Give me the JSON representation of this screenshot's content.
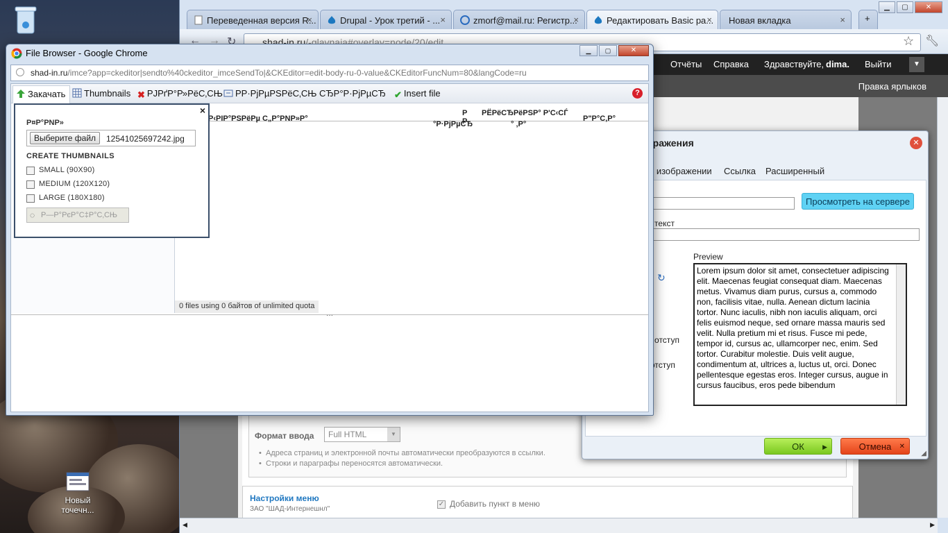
{
  "desktop": {
    "recycle_bin_icon": "trash-icon",
    "shortcut_label_line1": "Новый",
    "shortcut_label_line2": "точечн..."
  },
  "browser_back": {
    "tabs": [
      {
        "label": "Переведенная версия R...",
        "active": false
      },
      {
        "label": "Drupal - Урок третий - ...",
        "active": false
      },
      {
        "label": "zmorf@mail.ru: Регистр...",
        "active": false
      },
      {
        "label": "Редактировать Basic pa...",
        "active": true
      },
      {
        "label": "Новая вкладка",
        "active": false
      }
    ],
    "address_host": "shad-in.ru",
    "address_path": "/-glavnaja#overlay=node/20/edit",
    "admin_menu": {
      "reports": "Отчёты",
      "help": "Справка",
      "greeting": "Здравствуйте,",
      "username": "dima.",
      "logout": "Выйти"
    },
    "shortcut_link": "Правка ярлыков",
    "form": {
      "format_label": "Формат ввода",
      "format_value": "Full HTML",
      "hint1": "Адреса страниц и электронной почты автоматически преобразуются в ссылки.",
      "hint2": "Строки и параграфы переносятся автоматически.",
      "menu_settings": "Настройки меню",
      "menu_sub": "ЗАО \"ШАД-Интернешнл\"",
      "add_menu_item": "Добавить пункт в меню"
    }
  },
  "ck_dialog": {
    "title_fragment": "бражения",
    "tabs": [
      "о изображении",
      "Ссылка",
      "Расширенный"
    ],
    "browse_server": "Просмотреть на сервере",
    "alt_text_fragment": "й текст",
    "preview_label": "Preview",
    "preview_text": "Lorem ipsum dolor sit amet, consectetuer adipiscing elit. Maecenas feugiat consequat diam. Maecenas metus. Vivamus diam purus, cursus a, commodo non, facilisis vitae, nulla. Aenean dictum lacinia tortor. Nunc iaculis, nibh non iaculis aliquam, orci felis euismod neque, sed ornare massa mauris sed velit. Nulla pretium mi et risus. Fusce mi pede, tempor id, cursus ac, ullamcorper nec, enim. Sed tortor. Curabitur molestie. Duis velit augue, condimentum at, ultrices a, luctus ut, orci. Donec pellentesque egestas eros. Integer cursus, augue in cursus faucibus, eros pede bibendum",
    "hspace_fragment": "й отступ",
    "vspace_fragment": "отступ",
    "ok": "ОК",
    "cancel": "Отмена"
  },
  "file_browser": {
    "window_title": "File Browser - Google Chrome",
    "url_host": "shad-in.ru",
    "url_rest": "/imce?app=ckeditor|sendto%40ckeditor_imceSendTo|&CKEditor=edit-body-ru-0-value&CKEditorFuncNum=80&langCode=ru",
    "toolbar": {
      "upload": "Закачать",
      "thumbnails": "Thumbnails",
      "delete": "PJРґР°Р»РёС‚СЊ",
      "resize": "РР·РјРµРЅРёС‚СЊ СЂР°Р·РјРµСЂ",
      "insert": "Insert file",
      "help_icon": "help-icon"
    },
    "columns": {
      "name": "P‹PIP°PSPёPµ С„P°PNP»P°",
      "size_top": "Р Р",
      "size_bottom": "°Р·РјРµСЂ",
      "dims_top": "РЁРёСЂРёРЅР° Р'С‹СЃ",
      "dims_bottom": "° ‚Р°",
      "date": "Р\"P°С‚P°"
    },
    "status": "0 files using 0 байтов of unlimited quota",
    "upload_form": {
      "file_label": "Р¤Р°РNР»",
      "choose_button": "Выберите файл",
      "chosen_file": "12541025697242.jpg",
      "thumbs_heading": "CREATE THUMBNAILS",
      "options": [
        {
          "label": "SMALL (90X90)",
          "checked": false
        },
        {
          "label": "MEDIUM (120X120)",
          "checked": false
        },
        {
          "label": "LARGE (180X180)",
          "checked": false
        }
      ],
      "submit": "Р—Р°РєР°С‡Р°С‚СЊ"
    }
  }
}
